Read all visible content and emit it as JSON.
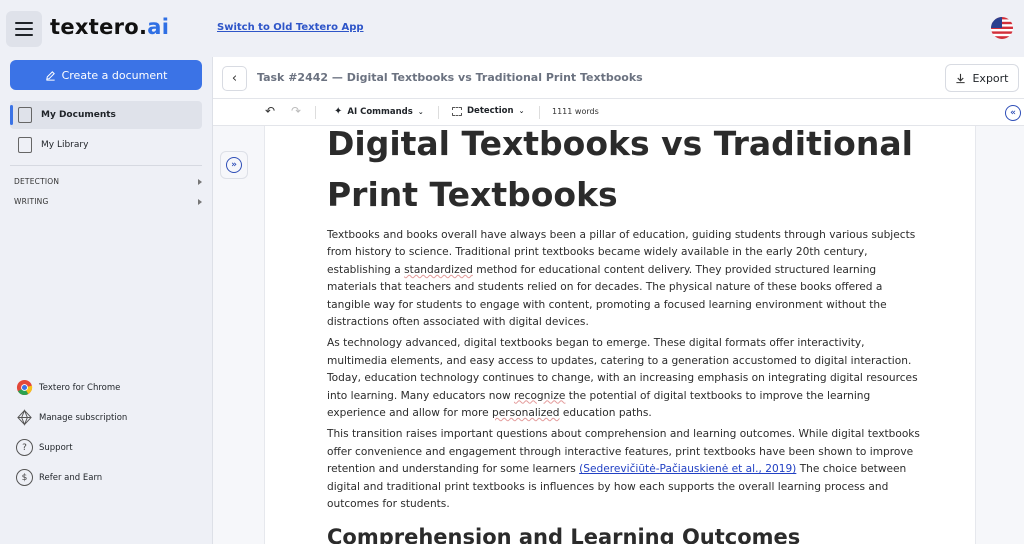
{
  "header": {
    "logo_main": "textero.",
    "logo_accent": "ai",
    "switch_link": "Switch to Old Textero App"
  },
  "sidebar": {
    "create_button": "Create a document",
    "items": [
      {
        "label": "My Documents"
      },
      {
        "label": "My Library"
      }
    ],
    "sections": [
      {
        "label": "DETECTION"
      },
      {
        "label": "WRITING"
      }
    ],
    "bottom_items": [
      {
        "label": "Textero for Chrome"
      },
      {
        "label": "Manage subscription"
      },
      {
        "label": "Support"
      },
      {
        "label": "Refer and Earn"
      }
    ]
  },
  "task": {
    "title": "Task #2442 — Digital Textbooks vs Traditional Print Textbooks",
    "export_label": "Export"
  },
  "toolbar": {
    "ai_commands": "AI Commands",
    "detection": "Detection",
    "word_count": "1111 words"
  },
  "document": {
    "title": "Digital Textbooks vs Traditional Print Textbooks",
    "p1_a": "Textbooks and books overall have always been a pillar of education, guiding students through various subjects from history to science. Traditional print textbooks became widely available in the early 20th century, establishing a ",
    "p1_sq": "standardized",
    "p1_b": " method for educational content delivery. They provided structured learning materials that teachers and students relied on for decades. The physical nature of these books offered a tangible way for students to engage with content, promoting a focused learning environment without the distractions often associated with digital devices.",
    "p2_a": "As technology advanced, digital textbooks began to emerge. These digital formats offer interactivity, multimedia elements, and easy access to updates, catering to a generation accustomed to digital interaction. Today, education technology continues to change, with an increasing emphasis on integrating digital resources into learning. Many educators now ",
    "p2_sq1": "recognize",
    "p2_b": " the potential of digital textbooks to improve the learning experience and allow for more ",
    "p2_sq2": "personalized",
    "p2_c": " education paths.",
    "p3_a": "This transition raises important questions about comprehension and learning outcomes. While digital textbooks offer convenience and engagement through interactive features, print textbooks have been shown to improve retention and understanding for some learners ",
    "p3_cite": "(Sederevičiūtė-Pačiauskienė et al., 2019)",
    "p3_b": " The choice between digital and traditional print textbooks is influences by how each supports the overall learning process and outcomes for students.",
    "h2": "Comprehension and Learning Outcomes"
  },
  "colors": {
    "accent": "#3b73e6",
    "link": "#2e55c8",
    "background": "#eef0f6"
  }
}
